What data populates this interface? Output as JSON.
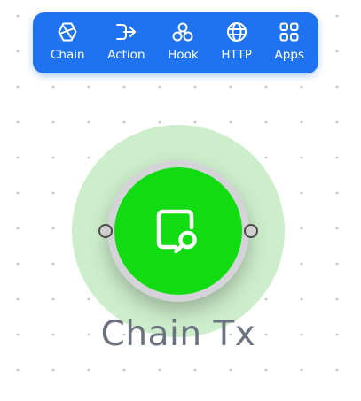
{
  "toolbar": {
    "items": [
      {
        "label": "Chain",
        "icon": "chain-icon"
      },
      {
        "label": "Action",
        "icon": "action-icon"
      },
      {
        "label": "Hook",
        "icon": "hook-icon"
      },
      {
        "label": "HTTP",
        "icon": "globe-icon"
      },
      {
        "label": "Apps",
        "icon": "apps-grid-icon"
      }
    ],
    "color": "#1f73f0"
  },
  "node": {
    "title": "Chain Tx",
    "icon": "document-search-icon",
    "core_color": "#11dc11",
    "halo_color": "#cdeecb",
    "ring_color": "#d4d4d8"
  }
}
